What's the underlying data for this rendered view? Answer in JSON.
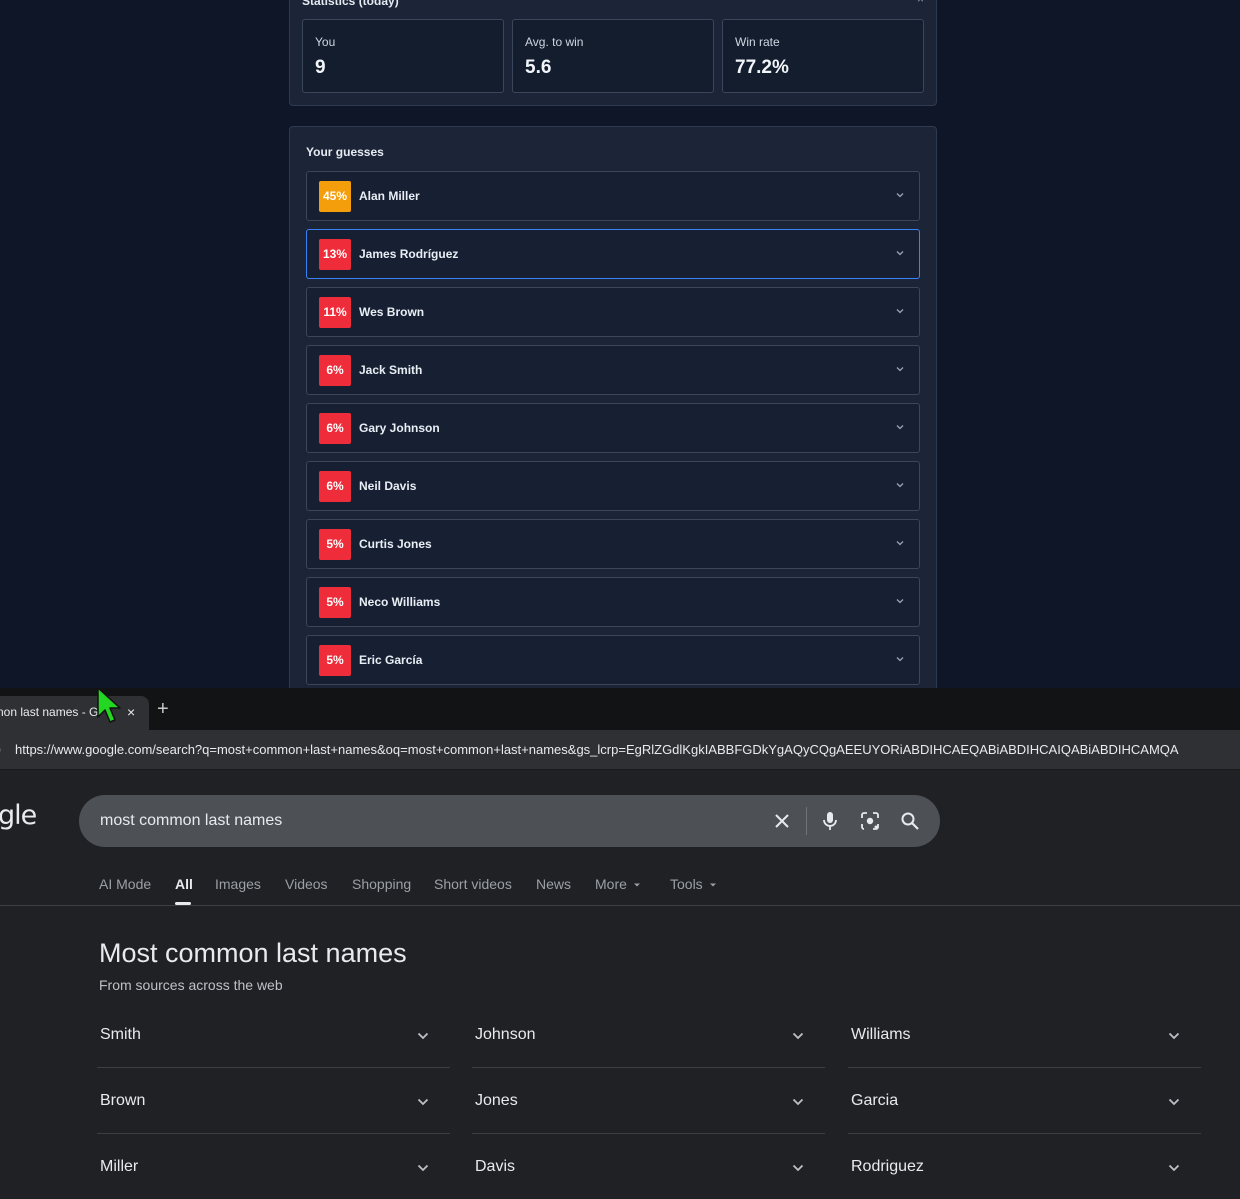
{
  "game": {
    "stats": {
      "title": "Statistics (today)",
      "close": "×",
      "cards": [
        {
          "label": "You",
          "value": "9"
        },
        {
          "label": "Avg. to win",
          "value": "5.6"
        },
        {
          "label": "Win rate",
          "value": "77.2%"
        }
      ]
    },
    "guesses": {
      "title": "Your guesses",
      "items": [
        {
          "pct": "45%",
          "name": "Alan Miller",
          "color": "#f59e0b"
        },
        {
          "pct": "13%",
          "name": "James Rodríguez",
          "color": "#ef2d3a"
        },
        {
          "pct": "11%",
          "name": "Wes Brown",
          "color": "#ef2d3a"
        },
        {
          "pct": "6%",
          "name": "Jack Smith",
          "color": "#ef2d3a"
        },
        {
          "pct": "6%",
          "name": "Gary Johnson",
          "color": "#ef2d3a"
        },
        {
          "pct": "6%",
          "name": "Neil Davis",
          "color": "#ef2d3a"
        },
        {
          "pct": "5%",
          "name": "Curtis Jones",
          "color": "#ef2d3a"
        },
        {
          "pct": "5%",
          "name": "Neco Williams",
          "color": "#ef2d3a"
        },
        {
          "pct": "5%",
          "name": "Eric García",
          "color": "#ef2d3a"
        }
      ]
    }
  },
  "browser": {
    "tab_title": "non last names - G",
    "tab_close": "×",
    "new_tab": "+",
    "url_icon": ")",
    "url": "https://www.google.com/search?q=most+common+last+names&oq=most+common+last+names&gs_lcrp=EgRlZGdlKgkIABBFGDkYgAQyCQgAEEUYORiABDIHCAEQABiABDIHCAIQABiABDIHCAMQA",
    "logo": "gle",
    "search_query": "most common last names",
    "nav_tabs": [
      {
        "label": "AI Mode"
      },
      {
        "label": "All"
      },
      {
        "label": "Images"
      },
      {
        "label": "Videos"
      },
      {
        "label": "Shopping"
      },
      {
        "label": "Short videos"
      },
      {
        "label": "News"
      },
      {
        "label": "More"
      },
      {
        "label": "Tools"
      }
    ],
    "result_title": "Most common last names",
    "result_subtitle": "From sources across the web",
    "names": [
      "Smith",
      "Johnson",
      "Williams",
      "Brown",
      "Jones",
      "Garcia",
      "Miller",
      "Davis",
      "Rodriguez"
    ]
  }
}
